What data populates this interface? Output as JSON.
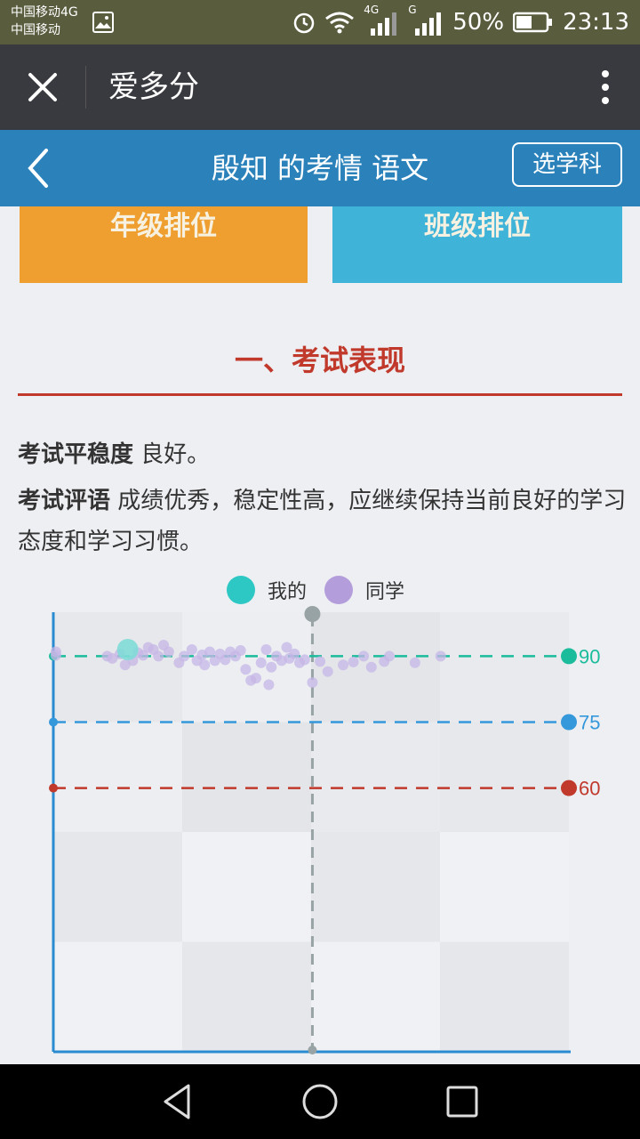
{
  "status_bar": {
    "carrier_line1": "中国移动4G",
    "carrier_line2": "中国移动",
    "net_label_1": "4G",
    "net_label_2": "G",
    "battery": "50%",
    "time": "23:13"
  },
  "wechat_bar": {
    "title": "爱多分"
  },
  "header": {
    "title": "殷知 的考情 语文",
    "subject_button": "选学科"
  },
  "rank_buttons": {
    "grade": "年级排位",
    "class": "班级排位"
  },
  "section": {
    "title": "一、考试表现"
  },
  "stability": {
    "label": "考试平稳度",
    "value": " 良好。"
  },
  "comment": {
    "label": "考试评语",
    "value": " 成绩优秀，稳定性高，应继续保持当前良好的学习态度和学习习惯。"
  },
  "legend": {
    "mine": "我的",
    "classmates": "同学"
  },
  "colors": {
    "accent_blue": "#2b82bb",
    "grade_orange": "#ef9f30",
    "class_cyan": "#3fb3d8",
    "title_red": "#c0392b",
    "line_90": "#1abc9c",
    "line_75": "#3498db",
    "line_60": "#c0392b",
    "mine": "#2ec8c4",
    "classmates": "#b39ddb"
  },
  "chart_data": {
    "type": "scatter",
    "series": [
      {
        "name": "我的",
        "points": [
          [
            2.8,
            91.5
          ]
        ]
      },
      {
        "name": "同学",
        "points": [
          [
            0.0,
            91.0
          ],
          [
            0.0,
            90.2
          ],
          [
            2.0,
            90.0
          ],
          [
            2.2,
            89.5
          ],
          [
            2.5,
            90.5
          ],
          [
            2.7,
            88.0
          ],
          [
            3.0,
            89.0
          ],
          [
            3.2,
            90.8
          ],
          [
            3.4,
            90.2
          ],
          [
            3.6,
            92.0
          ],
          [
            3.8,
            91.5
          ],
          [
            4.0,
            90.0
          ],
          [
            4.2,
            92.5
          ],
          [
            4.4,
            91.0
          ],
          [
            4.8,
            88.5
          ],
          [
            5.0,
            90.0
          ],
          [
            5.3,
            91.5
          ],
          [
            5.5,
            89.0
          ],
          [
            5.7,
            90.3
          ],
          [
            5.8,
            88.0
          ],
          [
            6.0,
            91.0
          ],
          [
            6.2,
            89.0
          ],
          [
            6.4,
            90.5
          ],
          [
            6.6,
            89.2
          ],
          [
            6.8,
            91.0
          ],
          [
            7.0,
            90.0
          ],
          [
            7.2,
            91.3
          ],
          [
            7.4,
            87.0
          ],
          [
            7.6,
            84.5
          ],
          [
            7.8,
            85.0
          ],
          [
            8.0,
            88.5
          ],
          [
            8.2,
            91.5
          ],
          [
            8.3,
            83.5
          ],
          [
            8.4,
            87.5
          ],
          [
            8.6,
            90.0
          ],
          [
            8.8,
            89.0
          ],
          [
            9.0,
            92.0
          ],
          [
            9.1,
            89.5
          ],
          [
            9.3,
            90.5
          ],
          [
            9.5,
            88.5
          ],
          [
            9.7,
            89.2
          ],
          [
            10.0,
            84.0
          ],
          [
            10.3,
            88.8
          ],
          [
            10.6,
            86.5
          ],
          [
            11.2,
            88.0
          ],
          [
            11.6,
            88.7
          ],
          [
            12.0,
            90.0
          ],
          [
            12.3,
            87.5
          ],
          [
            12.8,
            88.8
          ],
          [
            13.0,
            90.0
          ],
          [
            14.0,
            88.5
          ],
          [
            15.0,
            90.0
          ]
        ]
      }
    ],
    "reference_lines": [
      {
        "value": 90,
        "label": "90",
        "color": "#1abc9c"
      },
      {
        "value": 75,
        "label": "75",
        "color": "#3498db"
      },
      {
        "value": 60,
        "label": "60",
        "color": "#c0392b"
      }
    ],
    "marker_x": 10.0,
    "xlim": [
      -0.1,
      20
    ],
    "ylim": [
      0,
      100
    ]
  }
}
